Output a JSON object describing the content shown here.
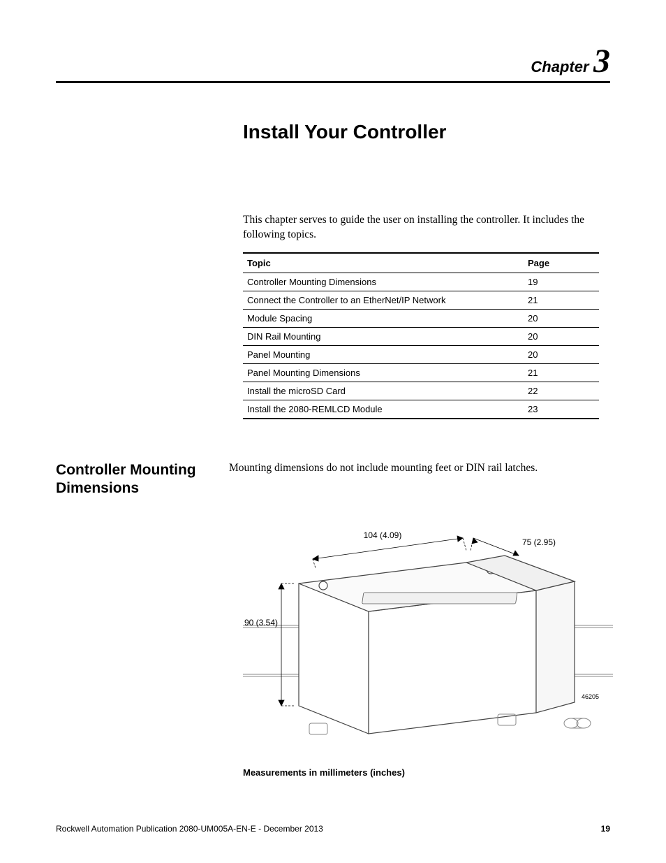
{
  "header": {
    "chapter_word": "Chapter",
    "chapter_num": "3"
  },
  "main_title": "Install Your Controller",
  "intro": "This chapter serves to guide the user on installing the controller. It includes the following topics.",
  "topics_table": {
    "headers": {
      "topic": "Topic",
      "page": "Page"
    },
    "rows": [
      {
        "topic": "Controller Mounting Dimensions",
        "page": "19"
      },
      {
        "topic": "Connect the Controller to an EtherNet/IP Network",
        "page": "21"
      },
      {
        "topic": "Module Spacing",
        "page": "20"
      },
      {
        "topic": "DIN Rail Mounting",
        "page": "20"
      },
      {
        "topic": "Panel Mounting",
        "page": "20"
      },
      {
        "topic": "Panel Mounting Dimensions",
        "page": "21"
      },
      {
        "topic": "Install the microSD Card",
        "page": "22"
      },
      {
        "topic": "Install the 2080-REMLCD Module",
        "page": "23"
      }
    ]
  },
  "section": {
    "heading": "Controller Mounting Dimensions",
    "body": "Mounting dimensions do not include mounting feet or DIN rail latches."
  },
  "figure": {
    "dim_width": "104 (4.09)",
    "dim_depth": "75 (2.95)",
    "dim_height": "90 (3.54)",
    "fig_id": "46205",
    "caption": "Measurements in millimeters (inches)"
  },
  "footer": {
    "pub": "Rockwell Automation Publication 2080-UM005A-EN-E - December 2013",
    "page": "19"
  }
}
